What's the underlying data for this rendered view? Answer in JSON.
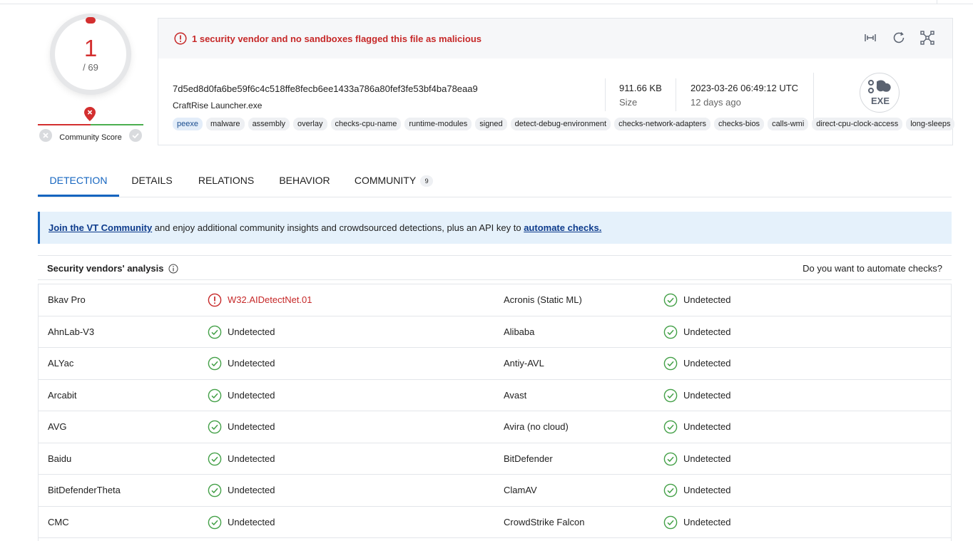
{
  "score": {
    "detections": "1",
    "total": "/ 69",
    "community_label": "Community Score"
  },
  "alert": {
    "text": "1 security vendor and no sandboxes flagged this file as malicious"
  },
  "file": {
    "hash": "7d5ed8d0fa6be59f6c4c518ffe8fecb6ee1433a786a80fef3fe53bf4ba78eaa9",
    "name": "CraftRise Launcher.exe",
    "size": "911.66 KB",
    "size_label": "Size",
    "date": "2023-03-26 06:49:12 UTC",
    "date_relative": "12 days ago",
    "type_badge": "EXE"
  },
  "tags": [
    "peexe",
    "malware",
    "assembly",
    "overlay",
    "checks-cpu-name",
    "runtime-modules",
    "signed",
    "detect-debug-environment",
    "checks-network-adapters",
    "checks-bios",
    "calls-wmi",
    "direct-cpu-clock-access",
    "long-sleeps"
  ],
  "tabs": [
    {
      "label": "DETECTION",
      "active": true
    },
    {
      "label": "DETAILS"
    },
    {
      "label": "RELATIONS"
    },
    {
      "label": "BEHAVIOR"
    },
    {
      "label": "COMMUNITY",
      "count": "9"
    }
  ],
  "banner": {
    "link1": "Join the VT Community",
    "middle": " and enjoy additional community insights and crowdsourced detections, plus an API key to ",
    "link2": "automate checks."
  },
  "analysis": {
    "title": "Security vendors' analysis",
    "automate": "Do you want to automate checks?"
  },
  "rows": [
    {
      "v1": "Bkav Pro",
      "r1": "W32.AIDetectNet.01",
      "r1_malicious": true,
      "v2": "Acronis (Static ML)",
      "r2": "Undetected"
    },
    {
      "v1": "AhnLab-V3",
      "r1": "Undetected",
      "v2": "Alibaba",
      "r2": "Undetected"
    },
    {
      "v1": "ALYac",
      "r1": "Undetected",
      "v2": "Antiy-AVL",
      "r2": "Undetected"
    },
    {
      "v1": "Arcabit",
      "r1": "Undetected",
      "v2": "Avast",
      "r2": "Undetected"
    },
    {
      "v1": "AVG",
      "r1": "Undetected",
      "v2": "Avira (no cloud)",
      "r2": "Undetected"
    },
    {
      "v1": "Baidu",
      "r1": "Undetected",
      "v2": "BitDefender",
      "r2": "Undetected"
    },
    {
      "v1": "BitDefenderTheta",
      "r1": "Undetected",
      "v2": "ClamAV",
      "r2": "Undetected"
    },
    {
      "v1": "CMC",
      "r1": "Undetected",
      "v2": "CrowdStrike Falcon",
      "r2": "Undetected"
    }
  ],
  "colors": {
    "malicious": "#c62828",
    "clean": "#43a047",
    "accent": "#1565c0"
  }
}
